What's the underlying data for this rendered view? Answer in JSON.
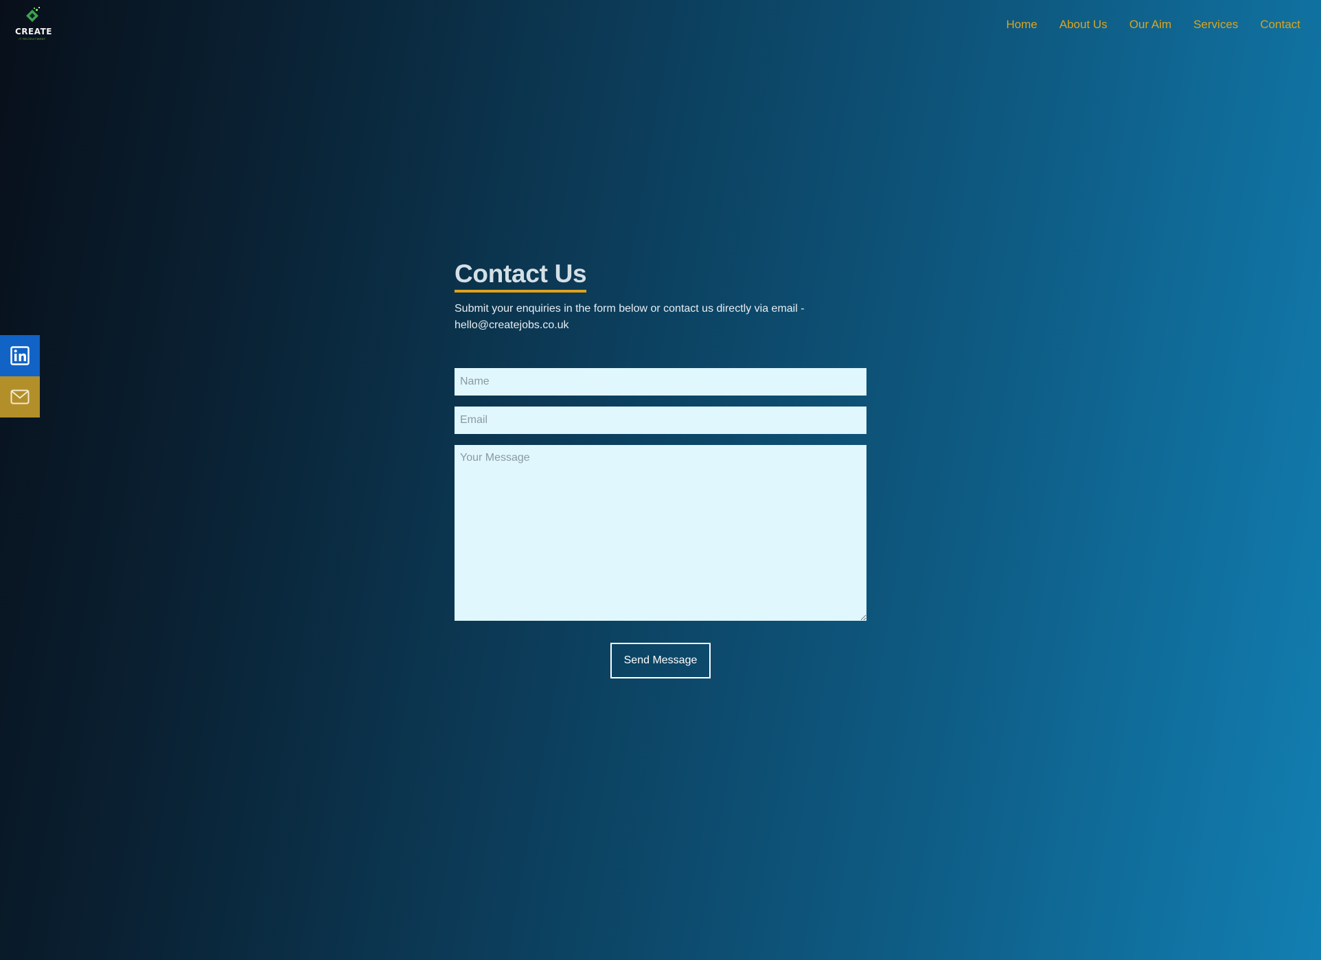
{
  "brand": {
    "logo_text": "CREATE",
    "logo_subtext": "IT RECRUITMENT"
  },
  "nav": {
    "items": [
      {
        "label": "Home"
      },
      {
        "label": "About Us"
      },
      {
        "label": "Our Aim"
      },
      {
        "label": "Services"
      },
      {
        "label": "Contact"
      }
    ]
  },
  "social": {
    "linkedin_icon": "linkedin-icon",
    "email_icon": "mail-icon"
  },
  "contact": {
    "title": "Contact Us",
    "intro": "Submit your enquiries in the form below or contact us directly via email -",
    "email": "hello@createjobs.co.uk",
    "form": {
      "name_placeholder": "Name",
      "name_value": "",
      "email_placeholder": "Email",
      "email_value": "",
      "message_placeholder": "Your Message",
      "message_value": "",
      "submit_label": "Send Message"
    }
  },
  "colors": {
    "nav_link": "#d9a521",
    "title_underline": "#e0a21c",
    "linkedin_bg": "#1163c6",
    "email_bg": "#b38f2a",
    "input_bg": "#e0f7fd"
  }
}
